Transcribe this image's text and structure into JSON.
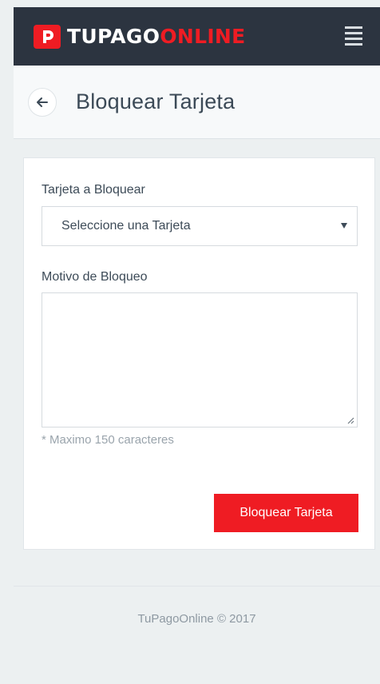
{
  "navbar": {
    "logo_part1": "TUPAGO",
    "logo_part2": "ONLINE",
    "brand_color": "#ef1c23",
    "logo_icon": "p-logo-icon",
    "menu_icon": "hamburger-menu-icon"
  },
  "header": {
    "back_icon": "arrow-left-icon",
    "title": "Bloquear Tarjeta"
  },
  "form": {
    "card_label": "Tarjeta a Bloquear",
    "card_select_value": "Seleccione una Tarjeta",
    "reason_label": "Motivo de Bloqueo",
    "reason_value": "",
    "hint": "* Maximo 150 caracteres",
    "submit_label": "Bloquear Tarjeta"
  },
  "footer": {
    "text": "TuPagoOnline © 2017"
  }
}
